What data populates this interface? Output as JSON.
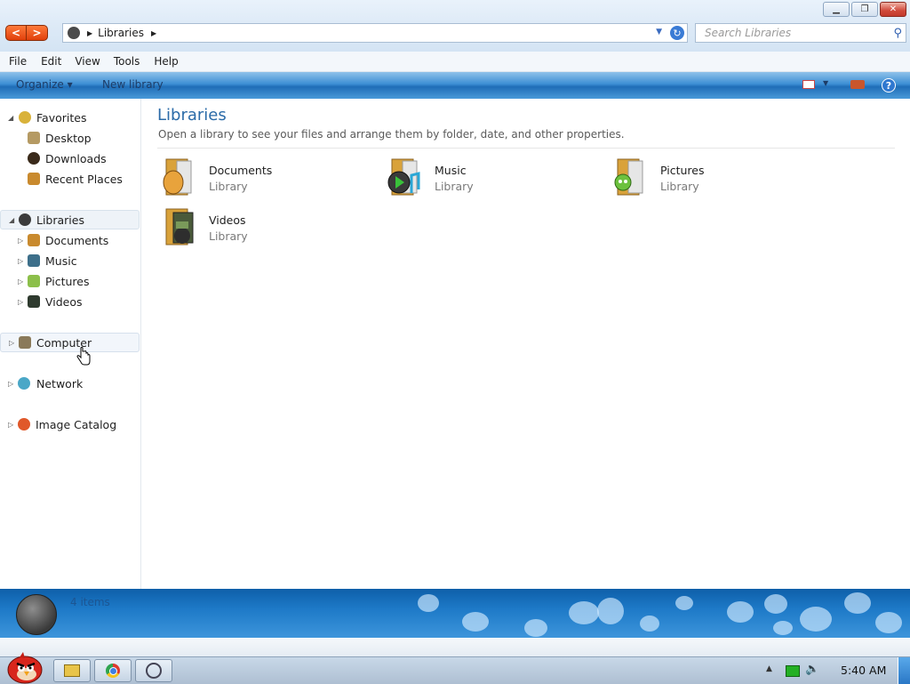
{
  "window": {
    "title": "Libraries",
    "controls": {
      "minimize": "▁",
      "restore": "❐",
      "close": "✕"
    }
  },
  "address": {
    "path": "Libraries",
    "search_placeholder": "Search Libraries"
  },
  "menu": [
    "File",
    "Edit",
    "View",
    "Tools",
    "Help"
  ],
  "commands": {
    "organize": "Organize ▾",
    "new_library": "New library",
    "help": "?"
  },
  "nav": {
    "favorites": {
      "label": "Favorites",
      "items": [
        "Desktop",
        "Downloads",
        "Recent Places"
      ]
    },
    "libraries": {
      "label": "Libraries",
      "items": [
        "Documents",
        "Music",
        "Pictures",
        "Videos"
      ]
    },
    "computer": "Computer",
    "network": "Network",
    "image_catalog": "Image Catalog"
  },
  "content": {
    "title": "Libraries",
    "description": "Open a library to see your files and arrange them by folder, date, and other properties.",
    "libraries": [
      {
        "name": "Documents",
        "type": "Library"
      },
      {
        "name": "Music",
        "type": "Library"
      },
      {
        "name": "Pictures",
        "type": "Library"
      },
      {
        "name": "Videos",
        "type": "Library"
      }
    ]
  },
  "details": {
    "item_count": "4 items"
  },
  "taskbar": {
    "clock": "5:40 AM"
  },
  "colors": {
    "accent": "#2b6ba8",
    "command_bar": "#3c8ed4",
    "nav_button": "#e0400c",
    "details_pane": "#1d79c7"
  }
}
